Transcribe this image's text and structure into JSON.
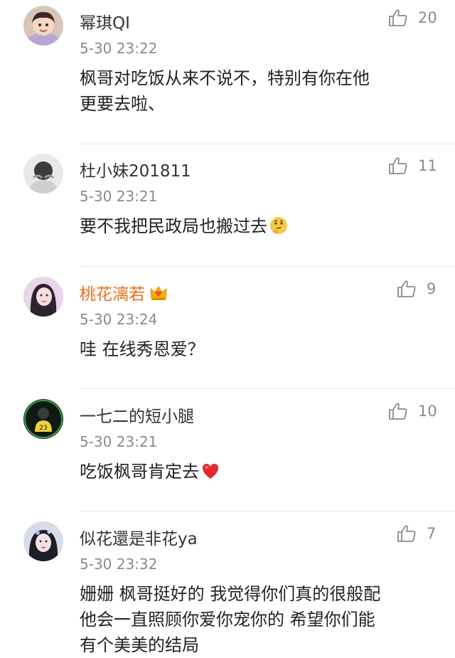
{
  "comments": [
    {
      "username": "幂琪QI",
      "timestamp": "5-30 23:22",
      "likes": "20",
      "lines": [
        "枫哥对吃饭从来不说不，特别有你在他",
        "更要去啦、"
      ]
    },
    {
      "username": "杜小妹201811",
      "timestamp": "5-30 23:21",
      "likes": "11",
      "lines": [
        "要不我把民政局也搬过去"
      ],
      "emoji": "thinking-face"
    },
    {
      "username": "桃花漓若",
      "timestamp": "5-30 23:24",
      "likes": "9",
      "lines": [
        "哇 在线秀恩爱？"
      ],
      "badge": "crown-vip-icon",
      "name_color": "#e8701a"
    },
    {
      "username": "一七二的短小腿",
      "timestamp": "5-30 23:21",
      "likes": "10",
      "lines": [
        "吃饭枫哥肯定去"
      ],
      "emoji": "red-heart"
    },
    {
      "username": "似花還是非花ya",
      "timestamp": "5-30 23:32",
      "likes": "7",
      "lines": [
        "姗姗 枫哥挺好的 我觉得你们真的很般配",
        "他会一直照顾你爱你宠你的 希望你们能",
        "有个美美的结局"
      ]
    }
  ],
  "colors": {
    "text": "#222222",
    "meta": "#8a8a8a",
    "vip_name": "#e8701a",
    "divider": "#e6e6e6"
  }
}
